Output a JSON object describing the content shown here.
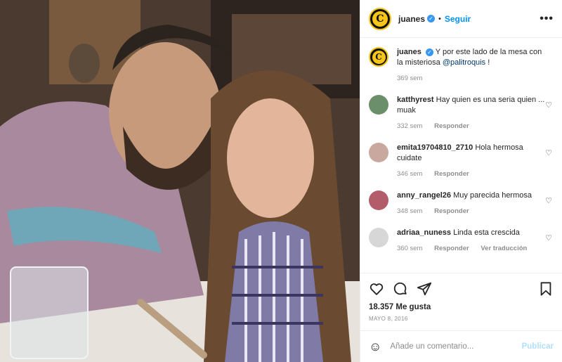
{
  "post": {
    "author": "juanes",
    "follow_label": "Seguir",
    "more_label": "•••",
    "logo_letter": "C",
    "caption": {
      "user": "juanes",
      "text": "Y por este lado de la mesa con la misteriosa",
      "mention": "@palitroquis",
      "suffix": "!",
      "age": "369 sem"
    },
    "comments": [
      {
        "user": "katthyrest",
        "text": "Hay quien es una seria quien ... muak",
        "age": "332 sem",
        "reply": "Responder",
        "avatar_color": "#6b8e6b"
      },
      {
        "user": "emita19704810_2710",
        "text": "Hola hermosa cuidate",
        "age": "346 sem",
        "reply": "Responder",
        "avatar_color": "#c9a8a0"
      },
      {
        "user": "anny_rangel26",
        "text": "Muy parecida hermosa",
        "age": "348 sem",
        "reply": "Responder",
        "avatar_color": "#b35c6a"
      },
      {
        "user": "adriaa_nuness",
        "text": "Linda esta crescida",
        "age": "360 sem",
        "reply": "Responder",
        "translate": "Ver traducción",
        "avatar_color": "#d7d7d7"
      }
    ],
    "likes": "18.357 Me gusta",
    "date": "MAYO 8, 2016",
    "add_comment_placeholder": "Añade un comentario...",
    "publish_label": "Publicar"
  }
}
